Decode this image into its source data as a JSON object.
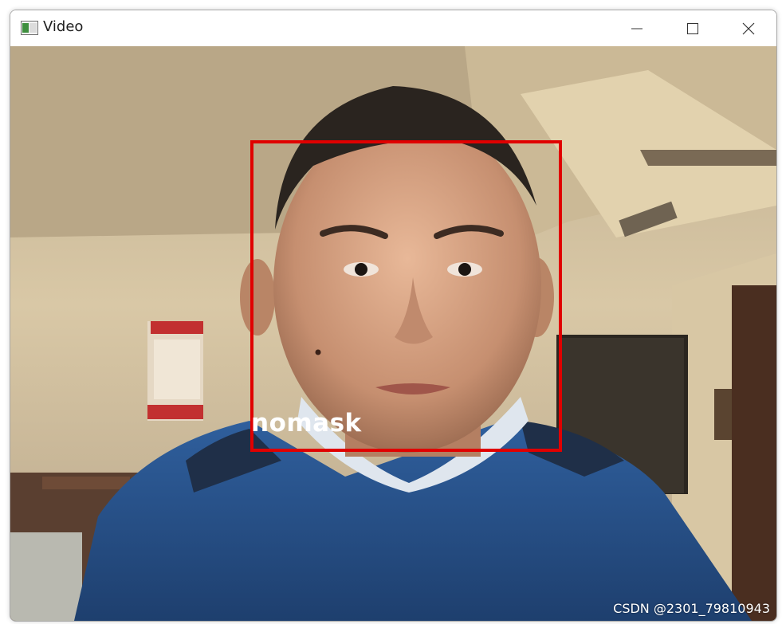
{
  "window": {
    "title": "Video",
    "controls": {
      "minimize": "minimize-icon",
      "maximize": "maximize-icon",
      "close": "close-icon"
    }
  },
  "video": {
    "detection": {
      "label": "nomask",
      "box_color": "#e00000"
    },
    "watermark": "CSDN @2301_79810943"
  }
}
